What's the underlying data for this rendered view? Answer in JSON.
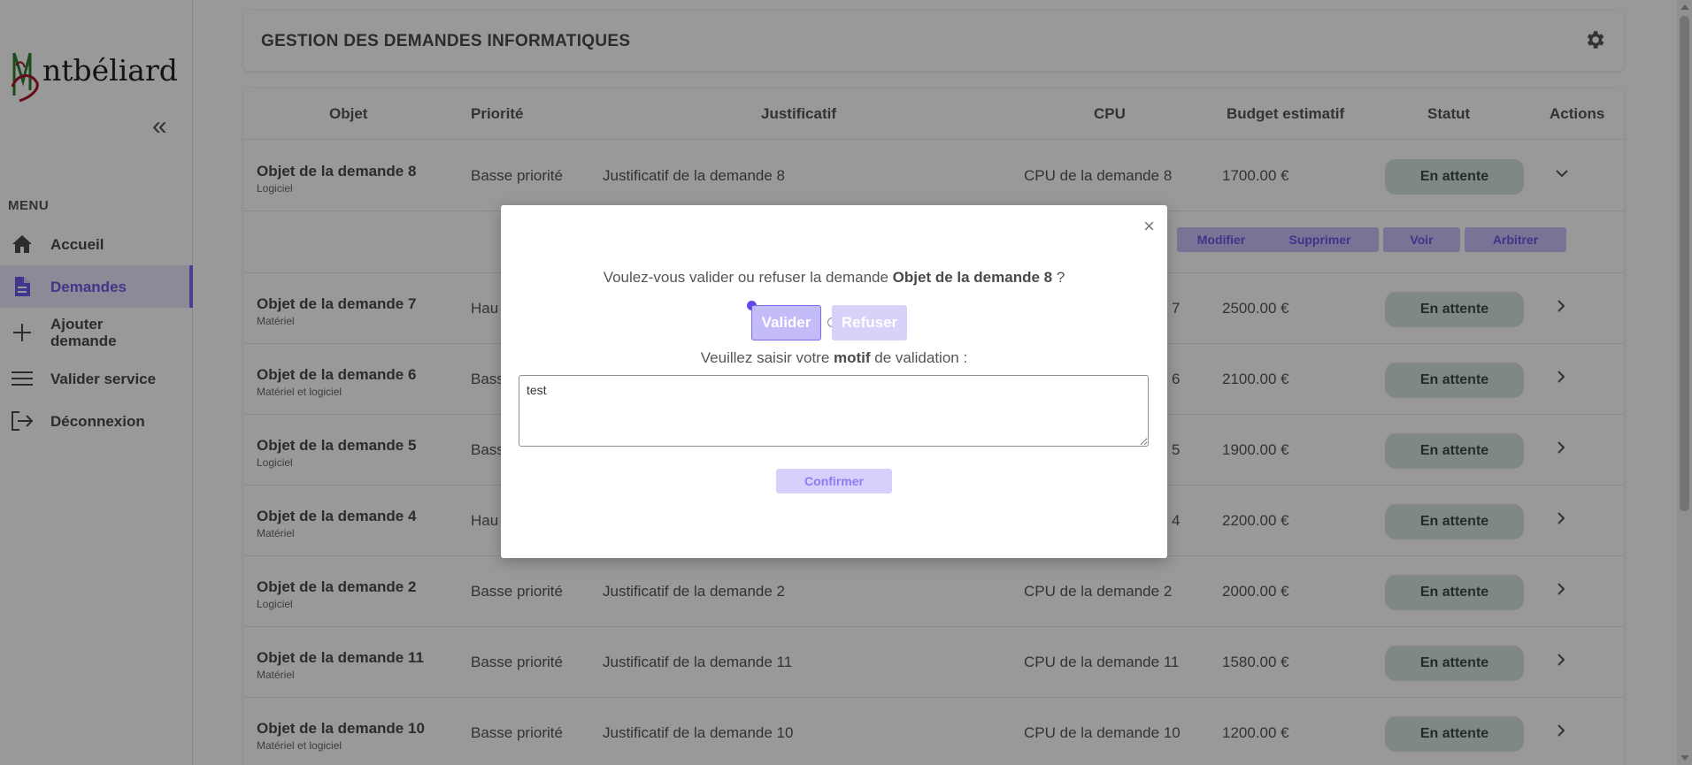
{
  "sidebar": {
    "logo_text": "ntbéliard",
    "menu_title": "MENU",
    "items": [
      {
        "label": "Accueil",
        "icon": "home-icon"
      },
      {
        "label": "Demandes",
        "icon": "document-icon"
      },
      {
        "label": "Ajouter demande",
        "icon": "plus-icon"
      },
      {
        "label": "Valider service",
        "icon": "menu-lines-icon"
      },
      {
        "label": "Déconnexion",
        "icon": "logout-icon"
      }
    ]
  },
  "header": {
    "title": "GESTION DES DEMANDES INFORMATIQUES"
  },
  "table": {
    "columns": [
      "Objet",
      "Priorité",
      "Justificatif",
      "CPU",
      "Budget estimatif",
      "Statut",
      "Actions"
    ],
    "rows": [
      {
        "objet": "Objet de la demande 8",
        "type": "Logiciel",
        "priorite": "Basse priorité",
        "justificatif": "Justificatif de la demande 8",
        "cpu": "CPU de la demande 8",
        "budget": "1700.00 €",
        "statut": "En attente"
      },
      {
        "objet": "Objet de la demande 7",
        "type": "Matériel",
        "priorite": "Hau",
        "justificatif": "",
        "cpu": "7",
        "budget": "2500.00 €",
        "statut": "En attente"
      },
      {
        "objet": "Objet de la demande 6",
        "type": "Matériel et logiciel",
        "priorite": "Bass",
        "justificatif": "",
        "cpu": "6",
        "budget": "2100.00 €",
        "statut": "En attente"
      },
      {
        "objet": "Objet de la demande 5",
        "type": "Logiciel",
        "priorite": "Bass",
        "justificatif": "",
        "cpu": "5",
        "budget": "1900.00 €",
        "statut": "En attente"
      },
      {
        "objet": "Objet de la demande 4",
        "type": "Matériel",
        "priorite": "Hau",
        "justificatif": "",
        "cpu": "4",
        "budget": "2200.00 €",
        "statut": "En attente"
      },
      {
        "objet": "Objet de la demande 2",
        "type": "Logiciel",
        "priorite": "Basse priorité",
        "justificatif": "Justificatif de la demande 2",
        "cpu": "CPU de la demande 2",
        "budget": "2000.00 €",
        "statut": "En attente"
      },
      {
        "objet": "Objet de la demande 11",
        "type": "Matériel",
        "priorite": "Basse priorité",
        "justificatif": "Justificatif de la demande 11",
        "cpu": "CPU de la demande 11",
        "budget": "1580.00 €",
        "statut": "En attente"
      },
      {
        "objet": "Objet de la demande 10",
        "type": "Matériel et logiciel",
        "priorite": "Basse priorité",
        "justificatif": "Justificatif de la demande 10",
        "cpu": "CPU de la demande 10",
        "budget": "1200.00 €",
        "statut": "En attente"
      }
    ],
    "row_actions": [
      "Modifier",
      "Supprimer",
      "Voir",
      "Arbitrer"
    ]
  },
  "modal": {
    "close": "×",
    "question_prefix": "Voulez-vous valider ou refuser la demande ",
    "question_object": "Objet de la demande 8",
    "question_suffix": " ?",
    "option_valider": "Valider",
    "option_refuser": "Refuser",
    "selected_option": "Valider",
    "motif_prefix": "Veuillez saisir votre ",
    "motif_bold": "motif",
    "motif_suffix": " de validation :",
    "motif_value": "test",
    "confirm_label": "Confirmer"
  },
  "colors": {
    "accent": "#6b5ae8",
    "accent_light": "#c9c2f8",
    "status_bg": "#d6e3e0",
    "overlay": "rgba(0,0,0,0.4)"
  }
}
